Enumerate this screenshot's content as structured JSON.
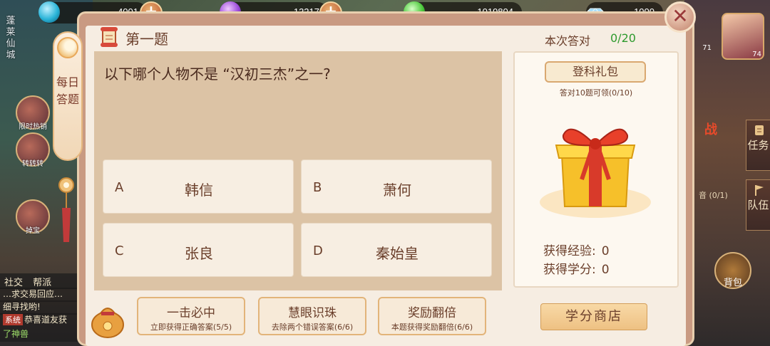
{
  "currencies": [
    {
      "value": "4001",
      "icon": "blue-orb-icon",
      "color": "#2ab4d8"
    },
    {
      "value": "13217",
      "icon": "purple-orb-icon",
      "color": "#9a4ad8"
    },
    {
      "value": "1019804",
      "icon": "green-orb-icon",
      "color": "#4ac83a"
    },
    {
      "value": "1000",
      "icon": "diamond-icon",
      "color": "#7ac8f0"
    }
  ],
  "background": {
    "city_name": "蓬莱仙城",
    "left_icons": [
      "限时热销",
      "转转转",
      "掉宝"
    ],
    "chat_tab": "社交",
    "chat_tab2": "帮派",
    "chat_lines": [
      "…求交易回应…",
      "细寻找哟!"
    ],
    "system_tag": "系统",
    "system_msg": "恭喜道友获",
    "system_msg2": "了神兽",
    "right_level": "71",
    "avatar_level": "74",
    "side_tabs": [
      "任务",
      "队伍"
    ],
    "backpack": "背包",
    "war_mark": "战",
    "map_small": "音 (0/1)"
  },
  "side_label": "每日答题",
  "header": {
    "title": "第一题",
    "stat_label": "本次答对",
    "stat_value": "0/20"
  },
  "question": "以下哪个人物不是 “汉初三杰”之一?",
  "options": [
    {
      "letter": "A",
      "answer": "韩信"
    },
    {
      "letter": "B",
      "answer": "萧何"
    },
    {
      "letter": "C",
      "answer": "张良"
    },
    {
      "letter": "D",
      "answer": "秦始皇"
    }
  ],
  "helpers": [
    {
      "name": "一击必中",
      "desc": "立即获得正确答案(5/5)"
    },
    {
      "name": "慧眼识珠",
      "desc": "去除两个错误答案(6/6)"
    },
    {
      "name": "奖励翻倍",
      "desc": "本题获得奖励翻倍(6/6)"
    }
  ],
  "reward": {
    "title": "登科礼包",
    "subtitle": "答对10题可领(0/10)",
    "exp_label": "获得经验:",
    "exp_value": "0",
    "score_label": "获得学分:",
    "score_value": "0",
    "shop_button": "学分商店"
  },
  "colors": {
    "accent_brown": "#6a3e2a",
    "progress_green": "#2e9a2e",
    "frame": "#c99a82"
  }
}
